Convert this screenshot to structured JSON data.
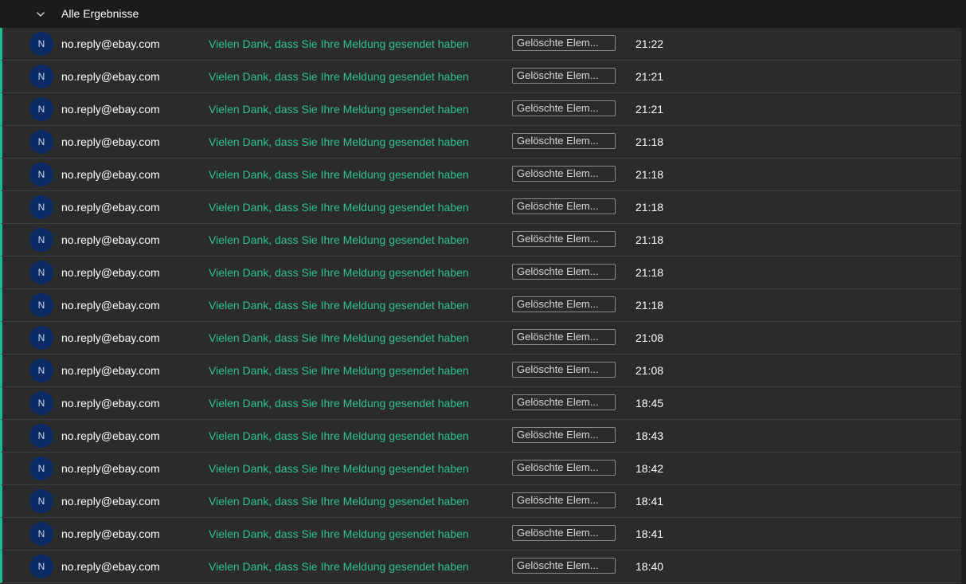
{
  "group": {
    "title": "Alle Ergebnisse",
    "icon": "chevron-down-icon"
  },
  "colors": {
    "accent": "#1fb98f",
    "subject": "#2ec294",
    "avatar_bg": "#0b2a63",
    "row_bg": "#2b2b2b"
  },
  "rows": [
    {
      "initial": "N",
      "sender": "no.reply@ebay.com",
      "subject": "Vielen Dank, dass Sie Ihre Meldung gesendet haben",
      "folder": "Gelöschte Elem...",
      "time": "21:22"
    },
    {
      "initial": "N",
      "sender": "no.reply@ebay.com",
      "subject": "Vielen Dank, dass Sie Ihre Meldung gesendet haben",
      "folder": "Gelöschte Elem...",
      "time": "21:21"
    },
    {
      "initial": "N",
      "sender": "no.reply@ebay.com",
      "subject": "Vielen Dank, dass Sie Ihre Meldung gesendet haben",
      "folder": "Gelöschte Elem...",
      "time": "21:21"
    },
    {
      "initial": "N",
      "sender": "no.reply@ebay.com",
      "subject": "Vielen Dank, dass Sie Ihre Meldung gesendet haben",
      "folder": "Gelöschte Elem...",
      "time": "21:18"
    },
    {
      "initial": "N",
      "sender": "no.reply@ebay.com",
      "subject": "Vielen Dank, dass Sie Ihre Meldung gesendet haben",
      "folder": "Gelöschte Elem...",
      "time": "21:18"
    },
    {
      "initial": "N",
      "sender": "no.reply@ebay.com",
      "subject": "Vielen Dank, dass Sie Ihre Meldung gesendet haben",
      "folder": "Gelöschte Elem...",
      "time": "21:18"
    },
    {
      "initial": "N",
      "sender": "no.reply@ebay.com",
      "subject": "Vielen Dank, dass Sie Ihre Meldung gesendet haben",
      "folder": "Gelöschte Elem...",
      "time": "21:18"
    },
    {
      "initial": "N",
      "sender": "no.reply@ebay.com",
      "subject": "Vielen Dank, dass Sie Ihre Meldung gesendet haben",
      "folder": "Gelöschte Elem...",
      "time": "21:18"
    },
    {
      "initial": "N",
      "sender": "no.reply@ebay.com",
      "subject": "Vielen Dank, dass Sie Ihre Meldung gesendet haben",
      "folder": "Gelöschte Elem...",
      "time": "21:18"
    },
    {
      "initial": "N",
      "sender": "no.reply@ebay.com",
      "subject": "Vielen Dank, dass Sie Ihre Meldung gesendet haben",
      "folder": "Gelöschte Elem...",
      "time": "21:08"
    },
    {
      "initial": "N",
      "sender": "no.reply@ebay.com",
      "subject": "Vielen Dank, dass Sie Ihre Meldung gesendet haben",
      "folder": "Gelöschte Elem...",
      "time": "21:08"
    },
    {
      "initial": "N",
      "sender": "no.reply@ebay.com",
      "subject": "Vielen Dank, dass Sie Ihre Meldung gesendet haben",
      "folder": "Gelöschte Elem...",
      "time": "18:45"
    },
    {
      "initial": "N",
      "sender": "no.reply@ebay.com",
      "subject": "Vielen Dank, dass Sie Ihre Meldung gesendet haben",
      "folder": "Gelöschte Elem...",
      "time": "18:43"
    },
    {
      "initial": "N",
      "sender": "no.reply@ebay.com",
      "subject": "Vielen Dank, dass Sie Ihre Meldung gesendet haben",
      "folder": "Gelöschte Elem...",
      "time": "18:42"
    },
    {
      "initial": "N",
      "sender": "no.reply@ebay.com",
      "subject": "Vielen Dank, dass Sie Ihre Meldung gesendet haben",
      "folder": "Gelöschte Elem...",
      "time": "18:41"
    },
    {
      "initial": "N",
      "sender": "no.reply@ebay.com",
      "subject": "Vielen Dank, dass Sie Ihre Meldung gesendet haben",
      "folder": "Gelöschte Elem...",
      "time": "18:41"
    },
    {
      "initial": "N",
      "sender": "no.reply@ebay.com",
      "subject": "Vielen Dank, dass Sie Ihre Meldung gesendet haben",
      "folder": "Gelöschte Elem...",
      "time": "18:40"
    }
  ]
}
